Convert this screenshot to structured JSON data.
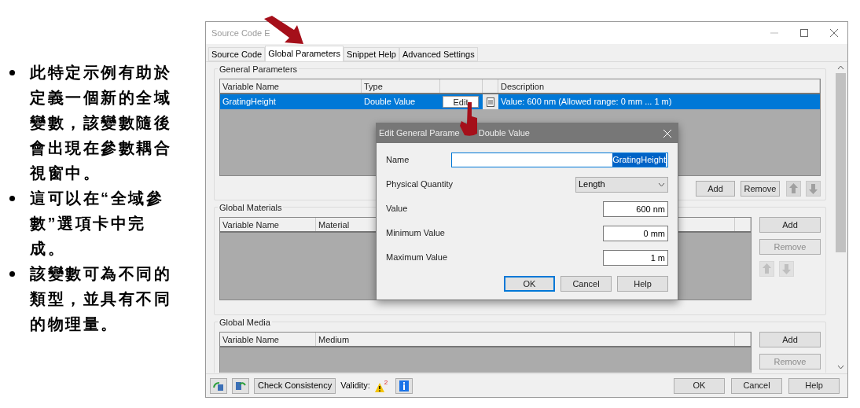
{
  "notes": [
    {
      "text": "此特定示例有助於定義一個新的全域變數，該變數隨後會出現在參數耦合視窗中。"
    },
    {
      "text": "這可以在“全域參數”選項卡中完成。"
    },
    {
      "text": "該變數可為不同的類型，並具有不同的物理量。"
    }
  ],
  "window": {
    "title": "Source Code E"
  },
  "tabs": [
    {
      "label": "Source Code",
      "selected": false
    },
    {
      "label": "Global Parameters",
      "selected": true
    },
    {
      "label": "Snippet Help",
      "selected": false
    },
    {
      "label": "Advanced Settings",
      "selected": false
    }
  ],
  "general_parameters": {
    "title": "General Parameters",
    "columns": [
      "Variable Name",
      "Type",
      "Description"
    ],
    "rows": [
      {
        "name": "GratingHeight",
        "type": "Double Value",
        "action": "Edit",
        "description": "Value: 600 nm (Allowed range: 0 mm ... 1 m)",
        "selected": true
      }
    ],
    "buttons": [
      {
        "label": "Add",
        "disabled": false
      },
      {
        "label": "Remove",
        "disabled": false
      }
    ],
    "move_disabled": false
  },
  "global_materials": {
    "title": "Global Materials",
    "columns": [
      "Variable Name",
      "Material"
    ],
    "buttons": [
      {
        "label": "Add",
        "disabled": false
      },
      {
        "label": "Remove",
        "disabled": true
      }
    ],
    "move_disabled": true
  },
  "global_media": {
    "title": "Global Media",
    "columns": [
      "Variable Name",
      "Medium"
    ],
    "buttons": [
      {
        "label": "Add",
        "disabled": false
      },
      {
        "label": "Remove",
        "disabled": true
      }
    ]
  },
  "footer": {
    "check_button": "Check Consistency",
    "validity_label": "Validity:",
    "warning_count": "2",
    "buttons": [
      "OK",
      "Cancel",
      "Help"
    ]
  },
  "dialog": {
    "title_start": "Edit General Parame",
    "title_end": "Double Value",
    "fields": [
      {
        "kind": "text",
        "label": "Name",
        "value": "GratingHeight",
        "highlighted": true
      },
      {
        "kind": "select",
        "label": "Physical Quantity",
        "value": "Length"
      },
      {
        "kind": "number",
        "label": "Value",
        "value": "600 nm"
      },
      {
        "kind": "number",
        "label": "Minimum Value",
        "value": "0 mm"
      },
      {
        "kind": "number",
        "label": "Maximum Value",
        "value": "1 m"
      }
    ],
    "buttons": [
      {
        "label": "OK",
        "default": true
      },
      {
        "label": "Cancel",
        "default": false
      },
      {
        "label": "Help",
        "default": false
      }
    ]
  }
}
